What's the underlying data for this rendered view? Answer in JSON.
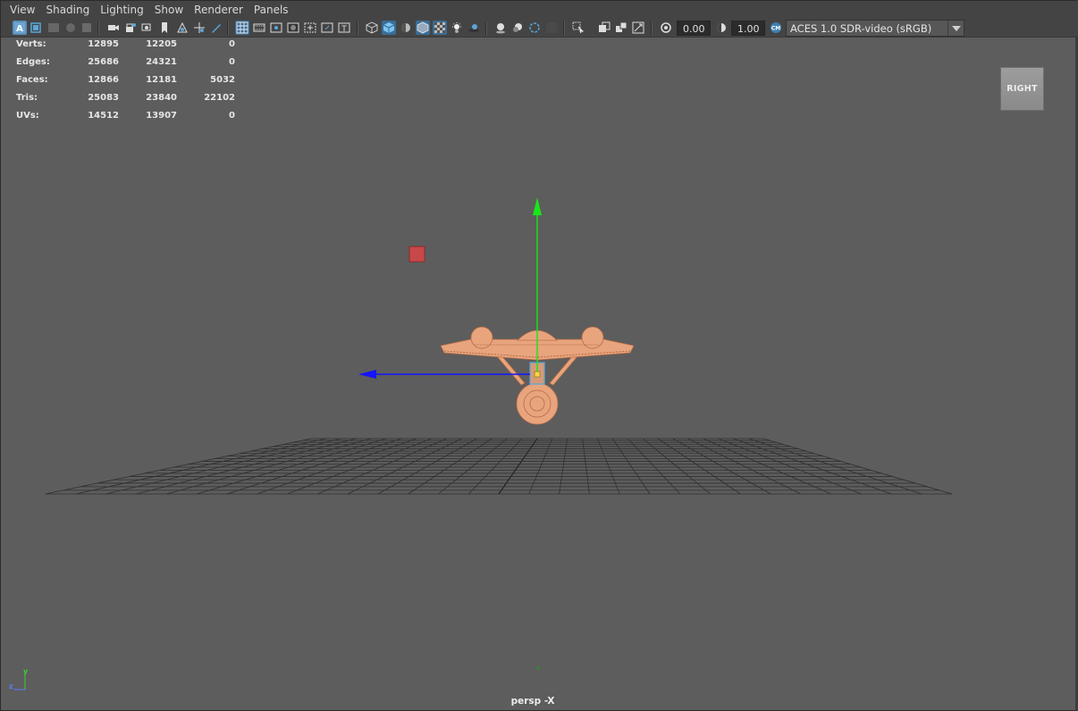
{
  "menubar": {
    "items": [
      "View",
      "Shading",
      "Lighting",
      "Show",
      "Renderer",
      "Panels"
    ]
  },
  "toolbar": {
    "exposure_value": "0.00",
    "gamma_value": "1.00",
    "color_management": "ACES 1.0 SDR-video (sRGB)",
    "icons": [
      "select-camera-icon",
      "isolate-select-icon",
      "camera-attributes-icon",
      "bookmark-icon",
      "image-plane-icon",
      "2d-pan-zoom-icon",
      "grease-pencil-icon",
      "grid-icon",
      "film-gate-icon",
      "resolution-gate-icon",
      "gate-mask-icon",
      "field-chart-icon",
      "safe-action-icon",
      "safe-title-icon",
      "wireframe-icon",
      "smooth-shade-icon",
      "default-material-icon",
      "wireframe-on-shaded-icon",
      "xray-icon",
      "use-all-lights-icon",
      "shadows-icon",
      "screen-space-ao-icon",
      "motion-blur-icon",
      "anti-aliasing-icon",
      "depth-of-field-icon",
      "isolate-icon",
      "xray-joints-icon",
      "xray-active-icon",
      "backface-culling-icon",
      "exposure-icon",
      "gamma-icon",
      "color-management-icon"
    ]
  },
  "hud": {
    "rows": [
      {
        "label": "Verts:",
        "a": "12895",
        "b": "12205",
        "c": "0"
      },
      {
        "label": "Edges:",
        "a": "25686",
        "b": "24321",
        "c": "0"
      },
      {
        "label": "Faces:",
        "a": "12866",
        "b": "12181",
        "c": "5032"
      },
      {
        "label": "Tris:",
        "a": "25083",
        "b": "23840",
        "c": "22102"
      },
      {
        "label": "UVs:",
        "a": "14512",
        "b": "13907",
        "c": "0"
      }
    ]
  },
  "viewcube": {
    "label": "RIGHT"
  },
  "viewport": {
    "camera_label": "persp -X",
    "axis_y": "y",
    "axis_z": "z",
    "colors": {
      "background": "#5d5d5d",
      "grid": "#2f2f2f",
      "model": "#e8a47d",
      "manip_y": "#19e619",
      "manip_z": "#1414ff",
      "light_marker": "#c84848"
    }
  }
}
